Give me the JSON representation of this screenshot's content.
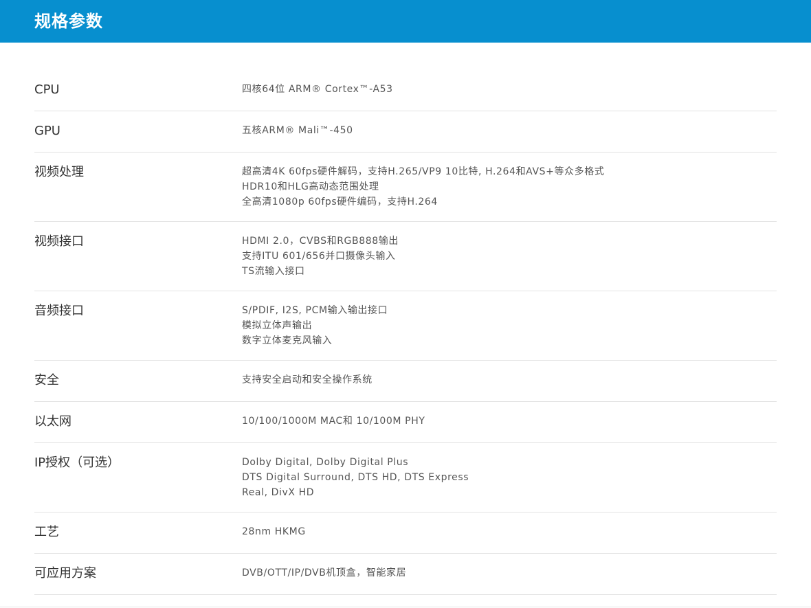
{
  "header": {
    "title": "规格参数"
  },
  "specs": [
    {
      "label": "CPU",
      "lines": [
        "四核64位 ARM® Cortex™-A53"
      ]
    },
    {
      "label": "GPU",
      "lines": [
        "五核ARM® Mali™-450"
      ]
    },
    {
      "label": "视频处理",
      "lines": [
        "超高清4K 60fps硬件解码，支持H.265/VP9 10比特, H.264和AVS+等众多格式",
        "HDR10和HLG高动态范围处理",
        "全高清1080p 60fps硬件编码，支持H.264"
      ]
    },
    {
      "label": "视频接口",
      "lines": [
        "HDMI 2.0，CVBS和RGB888输出",
        "支持ITU 601/656并口摄像头输入",
        "TS流输入接口"
      ]
    },
    {
      "label": "音频接口",
      "lines": [
        "S/PDIF, I2S, PCM输入输出接口",
        "模拟立体声输出",
        "数字立体麦克风输入"
      ]
    },
    {
      "label": "安全",
      "lines": [
        "支持安全启动和安全操作系统"
      ]
    },
    {
      "label": "以太网",
      "lines": [
        "10/100/1000M MAC和 10/100M PHY"
      ]
    },
    {
      "label": "IP授权（可选）",
      "lines": [
        "Dolby Digital, Dolby Digital Plus",
        "DTS Digital Surround, DTS HD, DTS Express",
        "Real, DivX HD"
      ]
    },
    {
      "label": "工艺",
      "lines": [
        "28nm HKMG"
      ]
    },
    {
      "label": "可应用方案",
      "lines": [
        "DVB/OTT/IP/DVB机顶盒，智能家居"
      ]
    }
  ]
}
